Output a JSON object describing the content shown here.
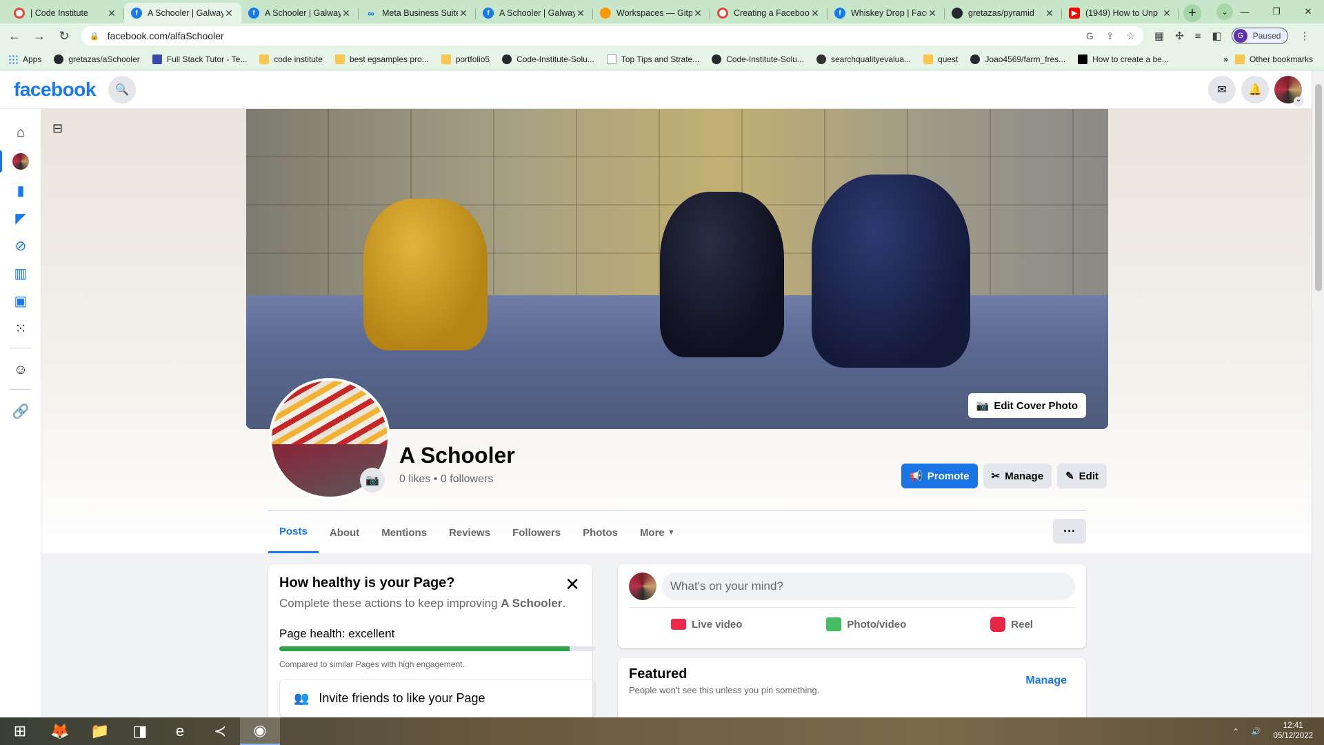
{
  "browser": {
    "tabs": [
      {
        "title": "| Code Institute",
        "icon": "code-institute-favicon",
        "active": false,
        "fav": "cred"
      },
      {
        "title": "A Schooler | Galway",
        "icon": "facebook-favicon",
        "active": true,
        "fav": "fb"
      },
      {
        "title": "A Schooler | Galway",
        "icon": "facebook-favicon",
        "active": false,
        "fav": "fb"
      },
      {
        "title": "Meta Business Suite",
        "icon": "meta-favicon",
        "active": false,
        "fav": "meta"
      },
      {
        "title": "A Schooler | Galway",
        "icon": "facebook-favicon",
        "active": false,
        "fav": "fb"
      },
      {
        "title": "Workspaces — Gitp",
        "icon": "gitpod-favicon",
        "active": false,
        "fav": "gp"
      },
      {
        "title": "Creating a Facebook",
        "icon": "code-institute-favicon",
        "active": false,
        "fav": "cred"
      },
      {
        "title": "Whiskey Drop | Face",
        "icon": "facebook-favicon",
        "active": false,
        "fav": "fb"
      },
      {
        "title": "gretazas/pyramid",
        "icon": "github-favicon",
        "active": false,
        "fav": "gh"
      },
      {
        "title": "(1949) How to Unp",
        "icon": "youtube-favicon",
        "active": false,
        "fav": "yt"
      }
    ],
    "url": "facebook.com/alfaSchooler",
    "profile_label": "Paused",
    "profile_initial": "G",
    "bookmarks": [
      {
        "label": "Apps",
        "icon": "apps"
      },
      {
        "label": "gretazas/aSchooler",
        "icon": "gh"
      },
      {
        "label": "Full Stack Tutor - Te...",
        "icon": "fst"
      },
      {
        "label": "code institute",
        "icon": "folder"
      },
      {
        "label": "best egsamples pro...",
        "icon": "folder"
      },
      {
        "label": "portfolio5",
        "icon": "folder"
      },
      {
        "label": "Code-Institute-Solu...",
        "icon": "gh"
      },
      {
        "label": "Top Tips and Strate...",
        "icon": "tt"
      },
      {
        "label": "Code-Institute-Solu...",
        "icon": "gh"
      },
      {
        "label": "searchqualityevalua...",
        "icon": "sq"
      },
      {
        "label": "quest",
        "icon": "folder"
      },
      {
        "label": "Joao4569/farm_fres...",
        "icon": "gh"
      },
      {
        "label": "How to create a be...",
        "icon": "yt"
      }
    ],
    "bookmarks_more": "»",
    "other_bookmarks": "Other bookmarks"
  },
  "facebook": {
    "logo": "facebook",
    "page_name": "A Schooler",
    "stats": "0 likes • 0 followers",
    "edit_cover": "Edit Cover Photo",
    "actions": {
      "promote": "Promote",
      "manage": "Manage",
      "edit": "Edit"
    },
    "tabs": [
      "Posts",
      "About",
      "Mentions",
      "Reviews",
      "Followers",
      "Photos",
      "More"
    ],
    "active_tab": "Posts",
    "health": {
      "title": "How healthy is your Page?",
      "subtitle_prefix": "Complete these actions to keep improving ",
      "subtitle_page": "A Schooler",
      "subtitle_suffix": ".",
      "level": "Page health: excellent",
      "level_fraction": 0.92,
      "comparison": "Compared to similar Pages with high engagement.",
      "invite": "Invite friends to like your Page"
    },
    "composer": {
      "placeholder": "What's on your mind?",
      "options": [
        "Live video",
        "Photo/video",
        "Reel"
      ]
    },
    "featured": {
      "title": "Featured",
      "subtitle": "People won't see this unless you pin something.",
      "manage": "Manage"
    }
  },
  "taskbar": {
    "time": "12:41",
    "date": "05/12/2022"
  },
  "colors": {
    "fb_blue": "#1877f2",
    "health_green": "#31a24c",
    "tab_bar": "#c8e6c9"
  }
}
